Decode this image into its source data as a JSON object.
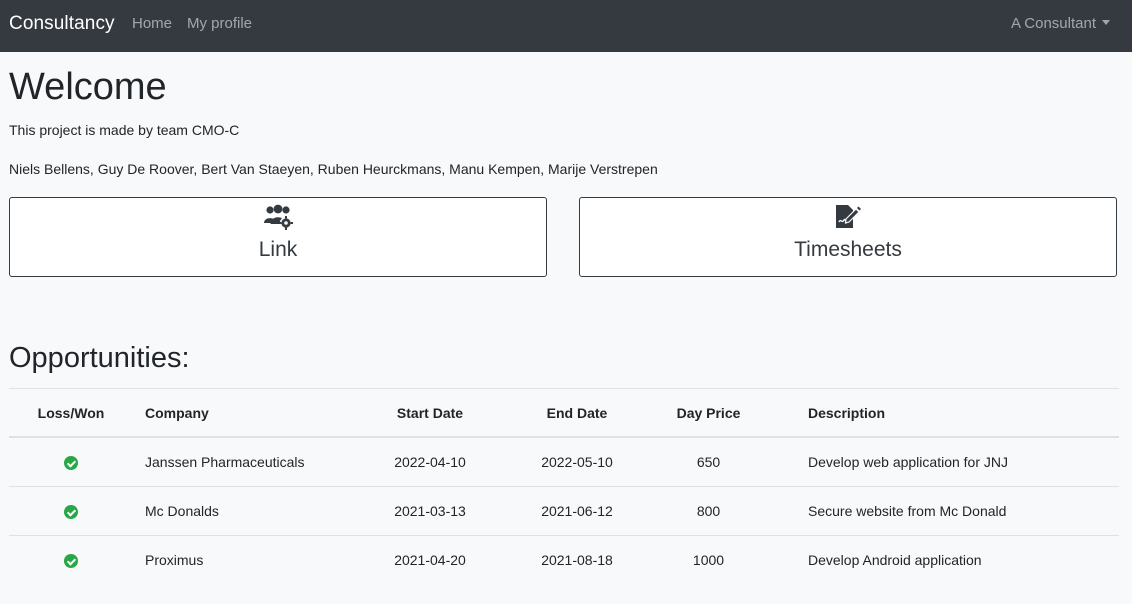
{
  "navbar": {
    "brand": "Consultancy",
    "links": [
      "Home",
      "My profile"
    ],
    "user": "A Consultant"
  },
  "welcome": {
    "title": "Welcome",
    "made_by": "This project is made by team CMO-C",
    "members": "Niels Bellens, Guy De Roover, Bert Van Staeyen, Ruben Heurckmans, Manu Kempen, Marije Verstrepen"
  },
  "cards": [
    {
      "label": "Link",
      "icon": "users-gear-icon"
    },
    {
      "label": "Timesheets",
      "icon": "file-signature-icon"
    }
  ],
  "opportunities": {
    "title": "Opportunities:",
    "columns": [
      "Loss/Won",
      "Company",
      "Start Date",
      "End Date",
      "Day Price",
      "Description"
    ],
    "rows": [
      {
        "status": "won",
        "company": "Janssen Pharmaceuticals",
        "start": "2022-04-10",
        "end": "2022-05-10",
        "price": "650",
        "description": "Develop web application for JNJ"
      },
      {
        "status": "won",
        "company": "Mc Donalds",
        "start": "2021-03-13",
        "end": "2021-06-12",
        "price": "800",
        "description": "Secure website from Mc Donald"
      },
      {
        "status": "won",
        "company": "Proximus",
        "start": "2021-04-20",
        "end": "2021-08-18",
        "price": "1000",
        "description": "Develop Android application"
      }
    ]
  },
  "colors": {
    "navbar": "#343a40",
    "success": "#28a745",
    "background": "#f8f9fa"
  }
}
